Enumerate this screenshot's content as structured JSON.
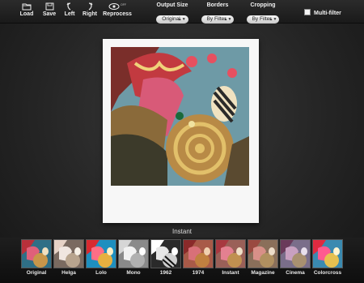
{
  "toolbar": {
    "load": "Load",
    "save": "Save",
    "left": "Left",
    "right": "Right",
    "reprocess": "Reprocess",
    "reprocess_state": "OFF",
    "output_size_label": "Output Size",
    "output_size_value": "Original",
    "borders_label": "Borders",
    "borders_value": "By Filter",
    "cropping_label": "Cropping",
    "cropping_value": "By Filter",
    "multi_filter_label": "Multi-filter",
    "multi_filter_checked": false
  },
  "preview": {
    "caption": "Instant"
  },
  "filters": [
    {
      "label": "Original",
      "tint": "#2f6f86"
    },
    {
      "label": "Helga",
      "tint": "#7a6a60"
    },
    {
      "label": "Lolo",
      "tint": "#1e8fbf"
    },
    {
      "label": "Mono",
      "tint": "#8a8a8a"
    },
    {
      "label": "1962",
      "tint": "#3a3a3a"
    },
    {
      "label": "1974",
      "tint": "#a85a48"
    },
    {
      "label": "Instant",
      "tint": "#9a6058"
    },
    {
      "label": "Magazine",
      "tint": "#8a6f5a"
    },
    {
      "label": "Cinema",
      "tint": "#7a6e8a"
    },
    {
      "label": "Colorcross",
      "tint": "#3a8ab0"
    }
  ]
}
